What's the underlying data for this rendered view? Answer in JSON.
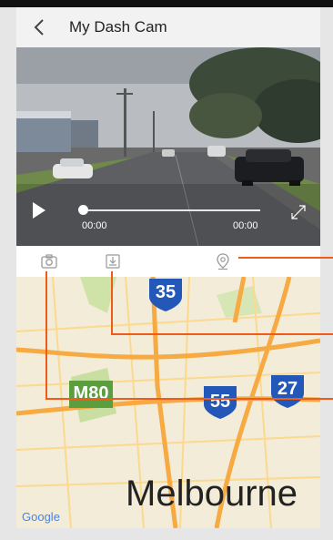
{
  "header": {
    "title": "My Dash Cam"
  },
  "player": {
    "current_time": "00:00",
    "duration": "00:00",
    "progress": 0
  },
  "toolbar": {
    "icons": [
      "camera-icon",
      "download-icon",
      "location-pin-icon"
    ]
  },
  "map": {
    "highways": [
      "35",
      "55",
      "27"
    ],
    "motorway": "M80",
    "city": "Melbourne",
    "attribution": "Google"
  },
  "colors": {
    "accent": "#f05a1a",
    "motorway_green": "#5a9e3e",
    "highway_blue": "#2357b8"
  }
}
